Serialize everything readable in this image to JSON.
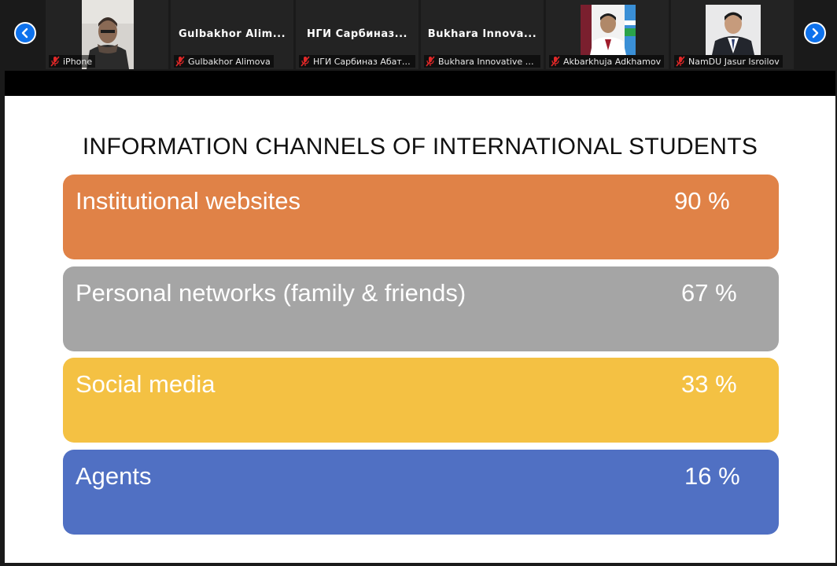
{
  "participants": [
    {
      "id": "iphone",
      "label": "iPhone",
      "has_photo": true
    },
    {
      "id": "gulbakhor",
      "tile_name": "Gulbakhor Alim...",
      "label": "Gulbakhor Alimova"
    },
    {
      "id": "ngi",
      "tile_name": "НГИ Сарбиназ...",
      "label": "НГИ Сарбиназ Абатовна"
    },
    {
      "id": "bukhara",
      "tile_name": "Bukhara Innova...",
      "label": "Bukhara Innovative Medi..."
    },
    {
      "id": "akbarkhuja",
      "label": "Akbarkhuja Adkhamov",
      "has_photo": true
    },
    {
      "id": "jasur",
      "label": "NamDU Jasur Isroilov",
      "has_photo": true
    }
  ],
  "slide": {
    "title": "INFORMATION CHANNELS OF INTERNATIONAL STUDENTS",
    "rows": [
      {
        "label": "Institutional websites",
        "value": "90 %",
        "color": "#e08247"
      },
      {
        "label": "Personal networks (family & friends)",
        "value": "67 %",
        "color": "#a5a5a5"
      },
      {
        "label": "Social media",
        "value": "33 %",
        "color": "#f4c143"
      },
      {
        "label": "Agents",
        "value": "16 %",
        "color": "#5070c3"
      }
    ]
  },
  "icons": {
    "prev": "chevron-left-icon",
    "next": "chevron-right-icon",
    "muted": "mic-muted-icon"
  },
  "colors": {
    "accent": "#0e72ed",
    "muted_mic": "#e02828"
  }
}
